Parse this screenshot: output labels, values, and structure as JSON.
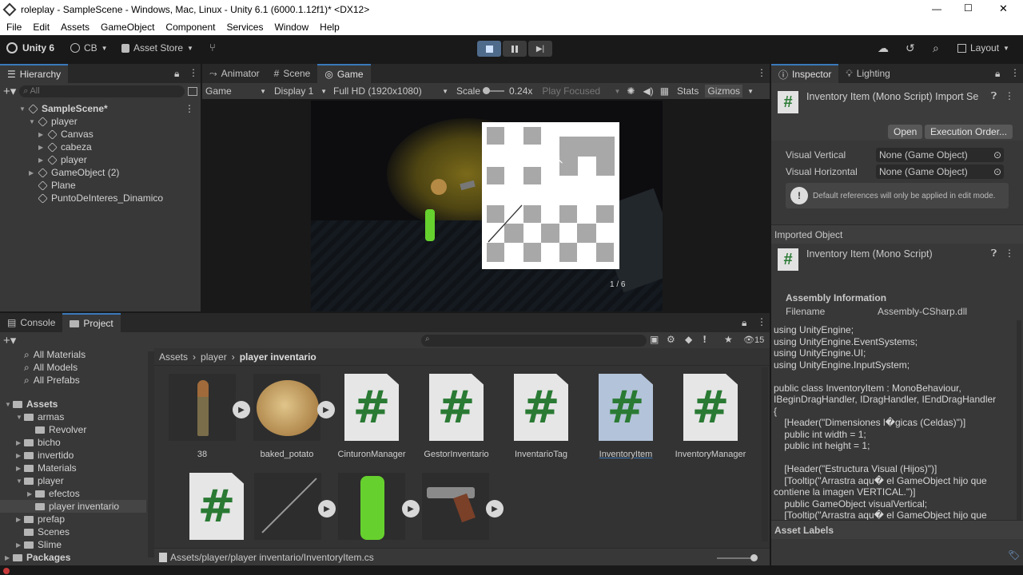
{
  "window": {
    "title": "roleplay - SampleScene - Windows, Mac, Linux - Unity 6.1 (6000.1.12f1)* <DX12>",
    "min": "—",
    "max": "☐",
    "close": "✕"
  },
  "menu": [
    "File",
    "Edit",
    "Assets",
    "GameObject",
    "Component",
    "Services",
    "Window",
    "Help"
  ],
  "toolbar": {
    "unity_label": "Unity 6",
    "account": "CB",
    "asset_store": "Asset Store",
    "layout": "Layout"
  },
  "hierarchy": {
    "tab": "Hierarchy",
    "search_placeholder": "All",
    "items": [
      {
        "label": "SampleScene*",
        "depth": 0,
        "kind": "scene"
      },
      {
        "label": "player",
        "depth": 1,
        "kind": "object"
      },
      {
        "label": "Canvas",
        "depth": 2,
        "kind": "object"
      },
      {
        "label": "cabeza",
        "depth": 2,
        "kind": "object"
      },
      {
        "label": "player",
        "depth": 2,
        "kind": "object"
      },
      {
        "label": "GameObject (2)",
        "depth": 1,
        "kind": "object"
      },
      {
        "label": "Plane",
        "depth": 1,
        "kind": "object"
      },
      {
        "label": "PuntoDeInteres_Dinamico",
        "depth": 1,
        "kind": "object"
      }
    ]
  },
  "game_view": {
    "tabs": [
      "Animator",
      "Scene",
      "Game"
    ],
    "display_mode": "Game",
    "display": "Display 1",
    "resolution": "Full HD (1920x1080)",
    "scale_label": "Scale",
    "scale_value": "0.24x",
    "play_mode": "Play Focused",
    "stats": "Stats",
    "gizmos": "Gizmos",
    "page_indicator": "1 / 6"
  },
  "inspector": {
    "tabs": [
      "Inspector",
      "Lighting"
    ],
    "title": "Inventory Item (Mono Script) Import Se",
    "open_button": "Open",
    "exec_button": "Execution Order...",
    "fields": [
      {
        "label": "Visual Vertical",
        "value": "None (Game Object)"
      },
      {
        "label": "Visual Horizontal",
        "value": "None (Game Object)"
      }
    ],
    "info": "Default references will only be applied in edit mode.",
    "imported_object_header": "Imported Object",
    "imported_object_title": "Inventory Item (Mono Script)",
    "assembly_header": "Assembly Information",
    "filename_label": "Filename",
    "filename_value": "Assembly-CSharp.dll",
    "code": "using UnityEngine;\nusing UnityEngine.EventSystems;\nusing UnityEngine.UI;\nusing UnityEngine.InputSystem;\n\npublic class InventoryItem : MonoBehaviour,\nIBeginDragHandler, IDragHandler, IEndDragHandler\n{\n    [Header(\"Dimensiones l�gicas (Celdas)\")]\n    public int width = 1;\n    public int height = 1;\n\n    [Header(\"Estructura Visual (Hijos)\")]\n    [Tooltip(\"Arrastra aqu� el GameObject hijo que\ncontiene la imagen VERTICAL.\")]\n    public GameObject visualVertical;\n    [Tooltip(\"Arrastra aqu� el GameObject hijo que",
    "asset_labels": "Asset Labels"
  },
  "bottom": {
    "tabs": [
      "Console",
      "Project"
    ],
    "hidden_count": "15",
    "favorites": [
      "All Materials",
      "All Models",
      "All Prefabs"
    ],
    "tree": [
      {
        "label": "Assets",
        "depth": 0,
        "open": true,
        "bold": true
      },
      {
        "label": "armas",
        "depth": 1,
        "open": true
      },
      {
        "label": "Revolver",
        "depth": 2,
        "open": false
      },
      {
        "label": "bicho",
        "depth": 1,
        "open": false
      },
      {
        "label": "invertido",
        "depth": 1,
        "open": false
      },
      {
        "label": "Materials",
        "depth": 1,
        "open": false
      },
      {
        "label": "player",
        "depth": 1,
        "open": true
      },
      {
        "label": "efectos",
        "depth": 2,
        "open": false
      },
      {
        "label": "player inventario",
        "depth": 2,
        "open": false,
        "selected": true
      },
      {
        "label": "prefap",
        "depth": 1,
        "open": false
      },
      {
        "label": "Scenes",
        "depth": 1,
        "open": false
      },
      {
        "label": "Slime",
        "depth": 1,
        "open": false
      },
      {
        "label": "Packages",
        "depth": 0,
        "open": false,
        "bold": true
      }
    ],
    "breadcrumb": [
      "Assets",
      "player",
      "player inventario"
    ],
    "assets": [
      {
        "label": "38",
        "kind": "bullet"
      },
      {
        "label": "baked_potato",
        "kind": "potato"
      },
      {
        "label": "CinturonManager",
        "kind": "script"
      },
      {
        "label": "GestorInventario",
        "kind": "script"
      },
      {
        "label": "InventarioTag",
        "kind": "script"
      },
      {
        "label": "InventoryItem",
        "kind": "script",
        "selected": true
      },
      {
        "label": "InventoryManager",
        "kind": "script"
      }
    ],
    "path": "Assets/player/player inventario/InventoryItem.cs"
  },
  "colors": {
    "accent": "#3a79bb",
    "script_green": "#2a7a34",
    "panel": "#383838",
    "candle": "#66d12e"
  }
}
